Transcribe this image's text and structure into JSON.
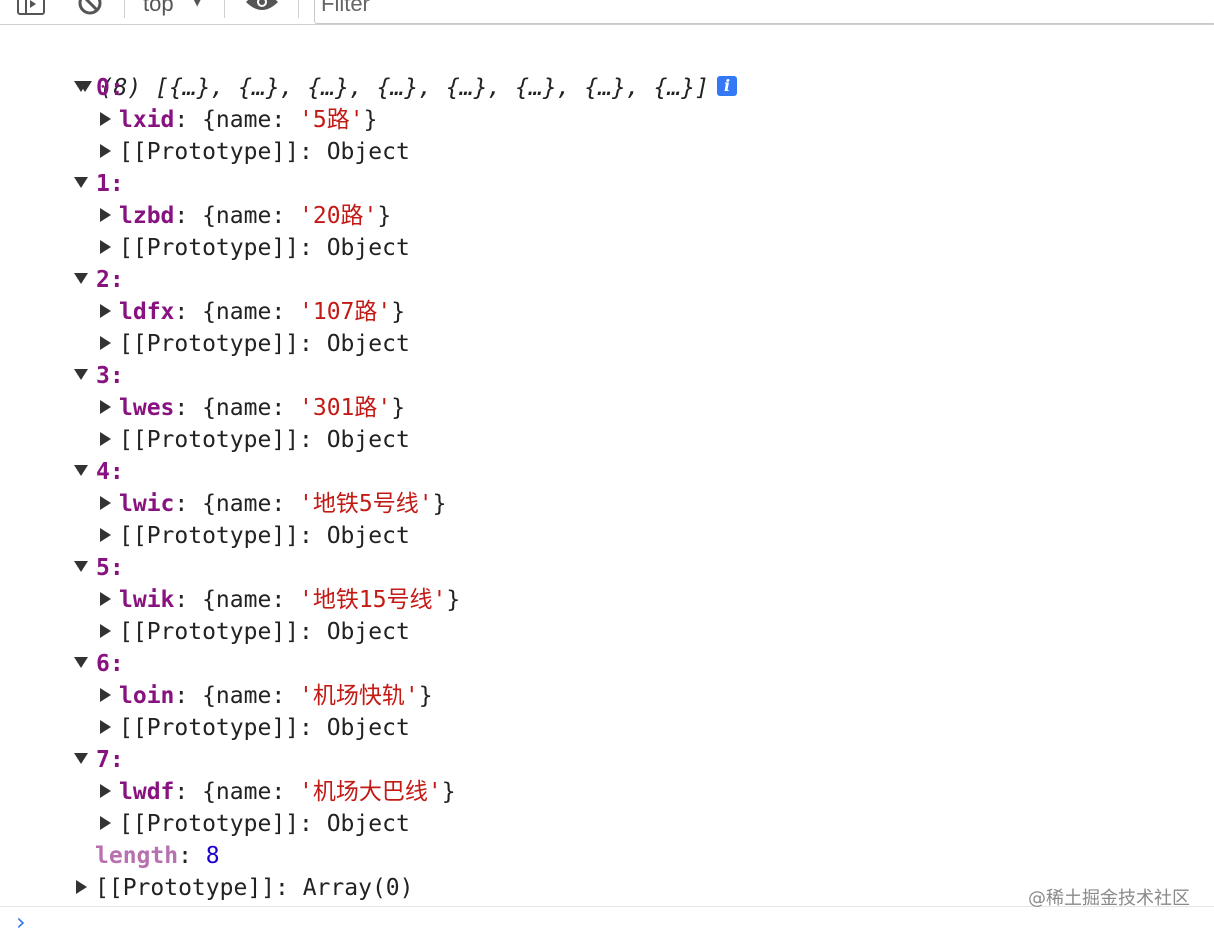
{
  "toolbar": {
    "context_label": "top",
    "filter_placeholder": "Filter",
    "icons": [
      "sidebar-toggle-icon",
      "clear-console-icon",
      "context-dropdown-caret-icon",
      "live-expression-eye-icon"
    ]
  },
  "console": {
    "summary": "(8) [{…}, {…}, {…}, {…}, {…}, {…}, {…}, {…}]",
    "entries": [
      {
        "index": "0:",
        "key": "lxid",
        "value": "'5路'"
      },
      {
        "index": "1:",
        "key": "lzbd",
        "value": "'20路'"
      },
      {
        "index": "2:",
        "key": "ldfx",
        "value": "'107路'"
      },
      {
        "index": "3:",
        "key": "lwes",
        "value": "'301路'"
      },
      {
        "index": "4:",
        "key": "lwic",
        "value": "'地铁5号线'"
      },
      {
        "index": "5:",
        "key": "lwik",
        "value": "'地铁15号线'"
      },
      {
        "index": "6:",
        "key": "loin",
        "value": "'机场快轨'"
      },
      {
        "index": "7:",
        "key": "lwdf",
        "value": "'机场大巴线'"
      }
    ],
    "obj_open": ": {name: ",
    "obj_close": "}",
    "proto_label": "[[Prototype]]",
    "proto_object": ": Object",
    "length_key": "length",
    "length_sep": ": ",
    "length_value": "8",
    "array_proto": ": Array(0)"
  },
  "prompt_glyph": "›",
  "watermark": "@稀土掘金技术社区",
  "colors": {
    "index": "#881280",
    "string": "#c41a16",
    "number": "#1c00cf",
    "length_key": "#b871b0",
    "info_badge": "#3478f6"
  }
}
